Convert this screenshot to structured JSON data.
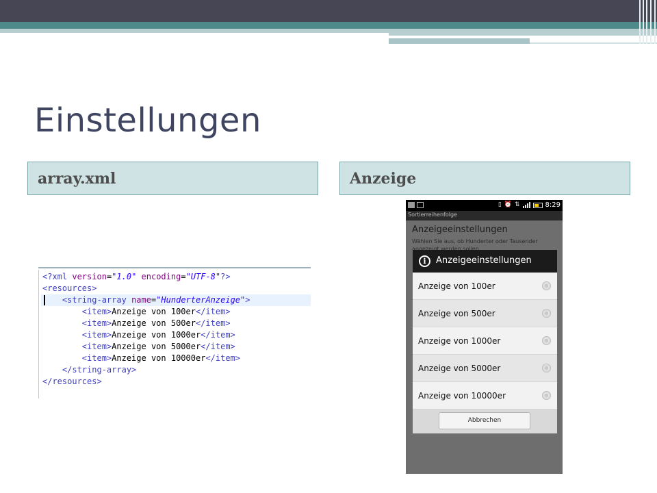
{
  "slide": {
    "title": "Einstellungen",
    "left_header": "array.xml",
    "right_header": "Anzeige"
  },
  "code": {
    "lines": [
      {
        "parts": [
          [
            "tag",
            "<?"
          ],
          [
            "tag",
            "xml "
          ],
          [
            "attr",
            "version"
          ],
          [
            "text",
            "="
          ],
          [
            "val",
            "\"1.0\""
          ],
          [
            "text",
            " "
          ],
          [
            "attr",
            "encoding"
          ],
          [
            "text",
            "="
          ],
          [
            "val",
            "\"UTF-8\""
          ],
          [
            "tag",
            "?>"
          ]
        ],
        "highlight": false
      },
      {
        "parts": [
          [
            "tag",
            "<resources>"
          ]
        ],
        "highlight": false
      },
      {
        "parts": [
          [
            "text",
            "    "
          ],
          [
            "tag",
            "<string-array "
          ],
          [
            "attr",
            "name"
          ],
          [
            "text",
            "="
          ],
          [
            "val",
            "\"HunderterAnzeige\""
          ],
          [
            "tag",
            ">"
          ]
        ],
        "highlight": true
      },
      {
        "parts": [
          [
            "text",
            "        "
          ],
          [
            "tag",
            "<item>"
          ],
          [
            "text",
            "Anzeige von 100er"
          ],
          [
            "tag",
            "</item>"
          ]
        ],
        "highlight": false
      },
      {
        "parts": [
          [
            "text",
            "        "
          ],
          [
            "tag",
            "<item>"
          ],
          [
            "text",
            "Anzeige von 500er"
          ],
          [
            "tag",
            "</item>"
          ]
        ],
        "highlight": false
      },
      {
        "parts": [
          [
            "text",
            "        "
          ],
          [
            "tag",
            "<item>"
          ],
          [
            "text",
            "Anzeige von 1000er"
          ],
          [
            "tag",
            "</item>"
          ]
        ],
        "highlight": false
      },
      {
        "parts": [
          [
            "text",
            "        "
          ],
          [
            "tag",
            "<item>"
          ],
          [
            "text",
            "Anzeige von 5000er"
          ],
          [
            "tag",
            "</item>"
          ]
        ],
        "highlight": false
      },
      {
        "parts": [
          [
            "text",
            "        "
          ],
          [
            "tag",
            "<item>"
          ],
          [
            "text",
            "Anzeige von 10000er"
          ],
          [
            "tag",
            "</item>"
          ]
        ],
        "highlight": false
      },
      {
        "parts": [
          [
            "text",
            "    "
          ],
          [
            "tag",
            "</string-array>"
          ]
        ],
        "highlight": false
      },
      {
        "parts": [
          [
            "tag",
            "</resources>"
          ]
        ],
        "highlight": false
      }
    ]
  },
  "phone": {
    "status_time": "8:29",
    "app_title": "Sortierreihenfolge",
    "pref_title": "Anzeigeeinstellungen",
    "pref_summary": "Wählen Sie aus, ob Hunderter oder Tausender angezeigt werden sollen",
    "dialog": {
      "title": "Anzeigeeinstellungen",
      "icon": "info-icon",
      "options": [
        "Anzeige von 100er",
        "Anzeige von 500er",
        "Anzeige von 1000er",
        "Anzeige von 5000er",
        "Anzeige von 10000er"
      ],
      "cancel_label": "Abbrechen"
    }
  },
  "colors": {
    "banner_dark": "#464655",
    "banner_teal": "#4f8a8b",
    "header_bg": "#cfe3e4",
    "title_text": "#3f4560"
  }
}
